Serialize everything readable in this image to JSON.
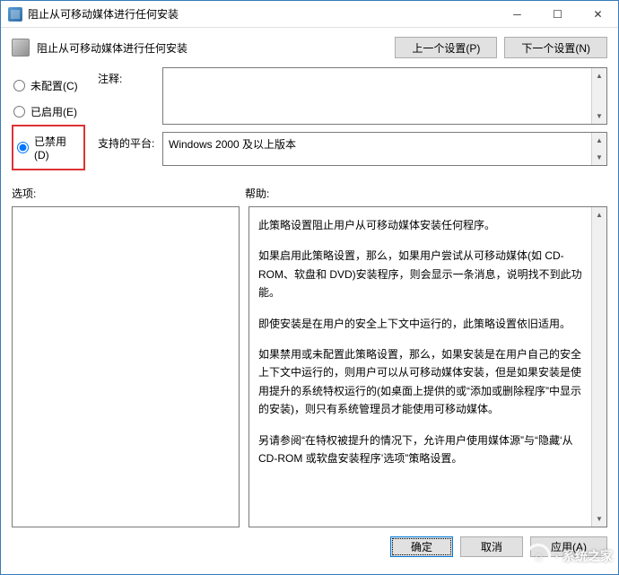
{
  "title": "阻止从可移动媒体进行任何安装",
  "header_label": "阻止从可移动媒体进行任何安装",
  "nav": {
    "prev": "上一个设置(P)",
    "next": "下一个设置(N)"
  },
  "radios": {
    "not_configured": "未配置(C)",
    "enabled": "已启用(E)",
    "disabled": "已禁用(D)"
  },
  "fields": {
    "comment_label": "注释:",
    "platform_label": "支持的平台:",
    "platform_value": "Windows 2000 及以上版本"
  },
  "sections": {
    "options_label": "选项:",
    "help_label": "帮助:"
  },
  "help": {
    "p1": "此策略设置阻止用户从可移动媒体安装任何程序。",
    "p2": "如果启用此策略设置，那么，如果用户尝试从可移动媒体(如 CD-ROM、软盘和 DVD)安装程序，则会显示一条消息，说明找不到此功能。",
    "p3": "即使安装是在用户的安全上下文中运行的，此策略设置依旧适用。",
    "p4": "如果禁用或未配置此策略设置，那么，如果安装是在用户自己的安全上下文中运行的，则用户可以从可移动媒体安装，但是如果安装是使用提升的系统特权运行的(如桌面上提供的或“添加或删除程序”中显示的安装)，则只有系统管理员才能使用可移动媒体。",
    "p5": "另请参阅“在特权被提升的情况下，允许用户使用媒体源”与“隐藏‘从CD-ROM 或软盘安装程序’选项”策略设置。"
  },
  "buttons": {
    "ok": "确定",
    "cancel": "取消",
    "apply": "应用(A)"
  },
  "watermark": "· 系统之家"
}
